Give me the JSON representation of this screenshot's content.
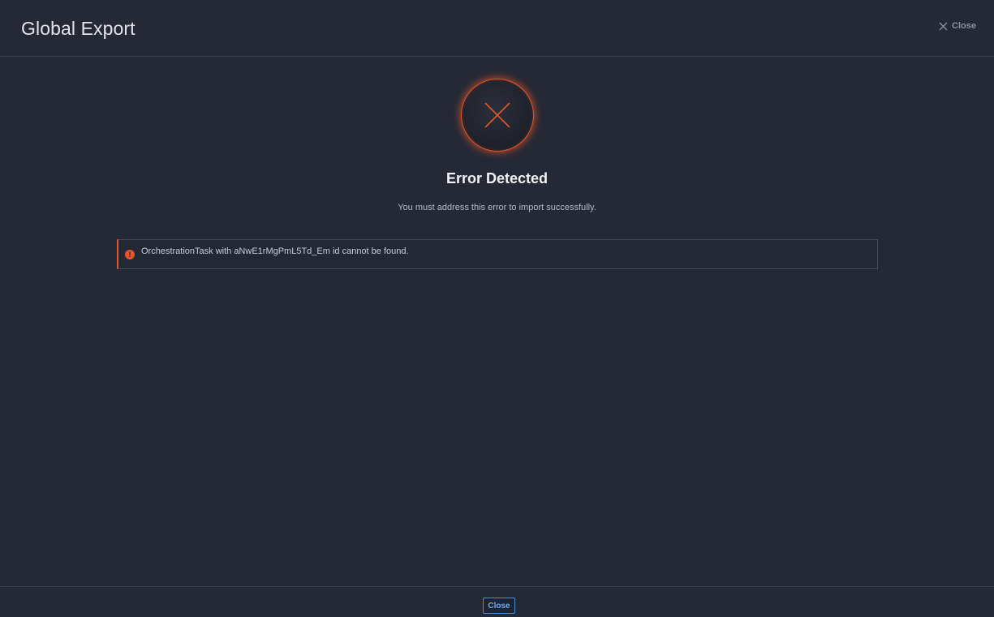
{
  "header": {
    "title": "Global Export",
    "close_label": "Close",
    "close_icon": "close-icon"
  },
  "status": {
    "icon": "error-x-icon",
    "accent_color": "#e4552a",
    "title": "Error Detected",
    "subtitle": "You must address this error to import successfully."
  },
  "errors": [
    {
      "icon": "exclamation-icon",
      "icon_glyph": "!",
      "message": "OrchestrationTask with aNwE1rMgPmL5Td_Em id cannot be found."
    }
  ],
  "footer": {
    "close_label": "Close",
    "button_color": "#4c8fdc"
  }
}
